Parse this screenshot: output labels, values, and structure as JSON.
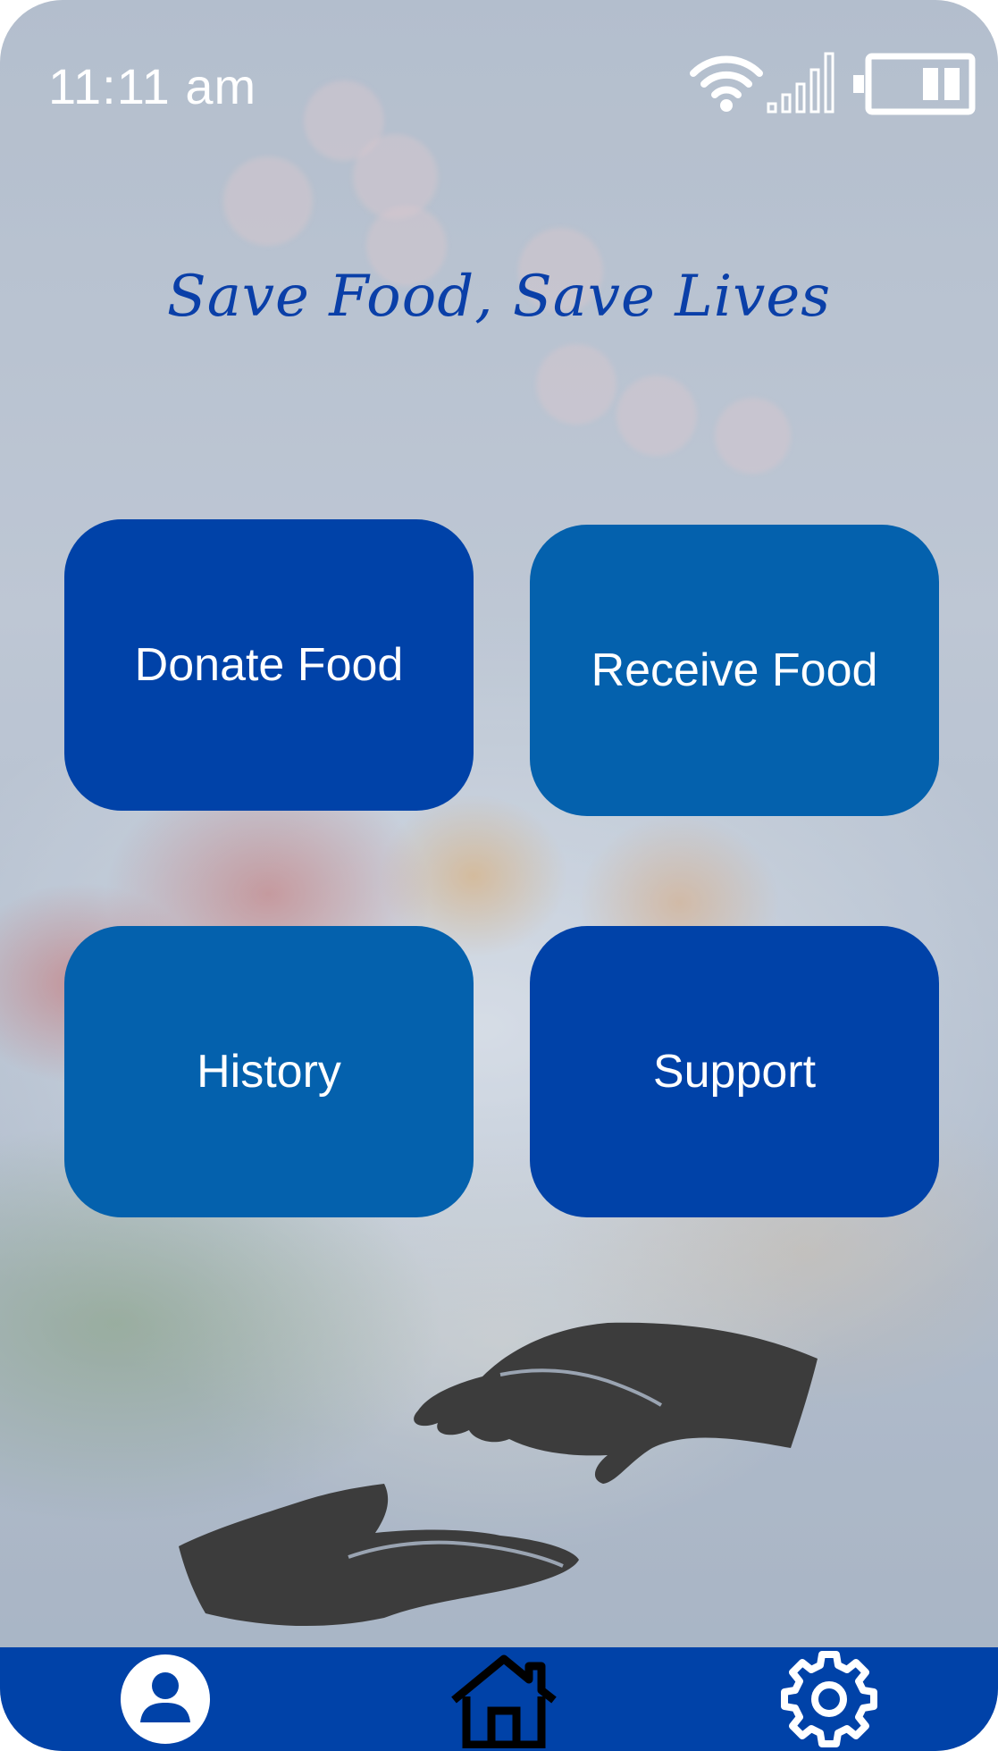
{
  "status_bar": {
    "time": "11:11 am",
    "icons": [
      "wifi-icon",
      "signal-icon",
      "battery-icon"
    ]
  },
  "headline": "Save Food, Save Lives",
  "tiles": [
    {
      "label": "Donate Food",
      "color": "#0042a8"
    },
    {
      "label": "Receive Food",
      "color": "#0461ad"
    },
    {
      "label": "History",
      "color": "#0461ad"
    },
    {
      "label": "Support",
      "color": "#0042a8"
    }
  ],
  "nav": {
    "items": [
      "profile-icon",
      "home-icon",
      "settings-icon"
    ],
    "background": "#0042a8"
  },
  "colors": {
    "headline": "#0a3fa8",
    "tile_dark": "#0042a8",
    "tile_mid": "#0461ad"
  }
}
